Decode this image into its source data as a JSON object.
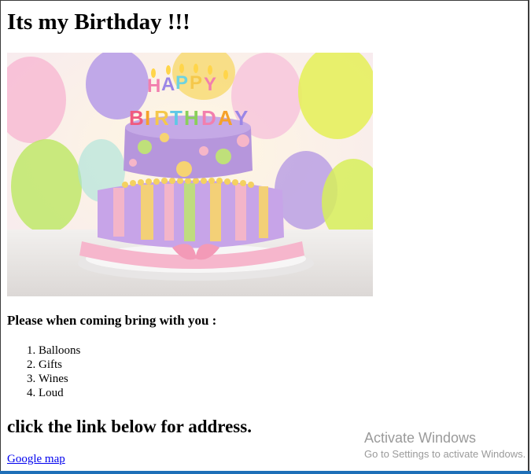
{
  "page": {
    "heading": "Its my Birthday !!!",
    "image": {
      "description_icon": "birthday-cake-image",
      "topper_text": "HAPPY BIRTHDAY"
    },
    "bring_heading": "Please when coming bring with you :",
    "bring_items": [
      "Balloons",
      "Gifts",
      "Wines",
      "Loud"
    ],
    "address_heading": "click the link below for address.",
    "map_link_label": "Google map"
  },
  "watermark": {
    "title": "Activate Windows",
    "subtitle": "Go to Settings to activate Windows."
  },
  "colors": {
    "link": "#0000ee",
    "taskbar_accent": "#1e6fb8"
  }
}
